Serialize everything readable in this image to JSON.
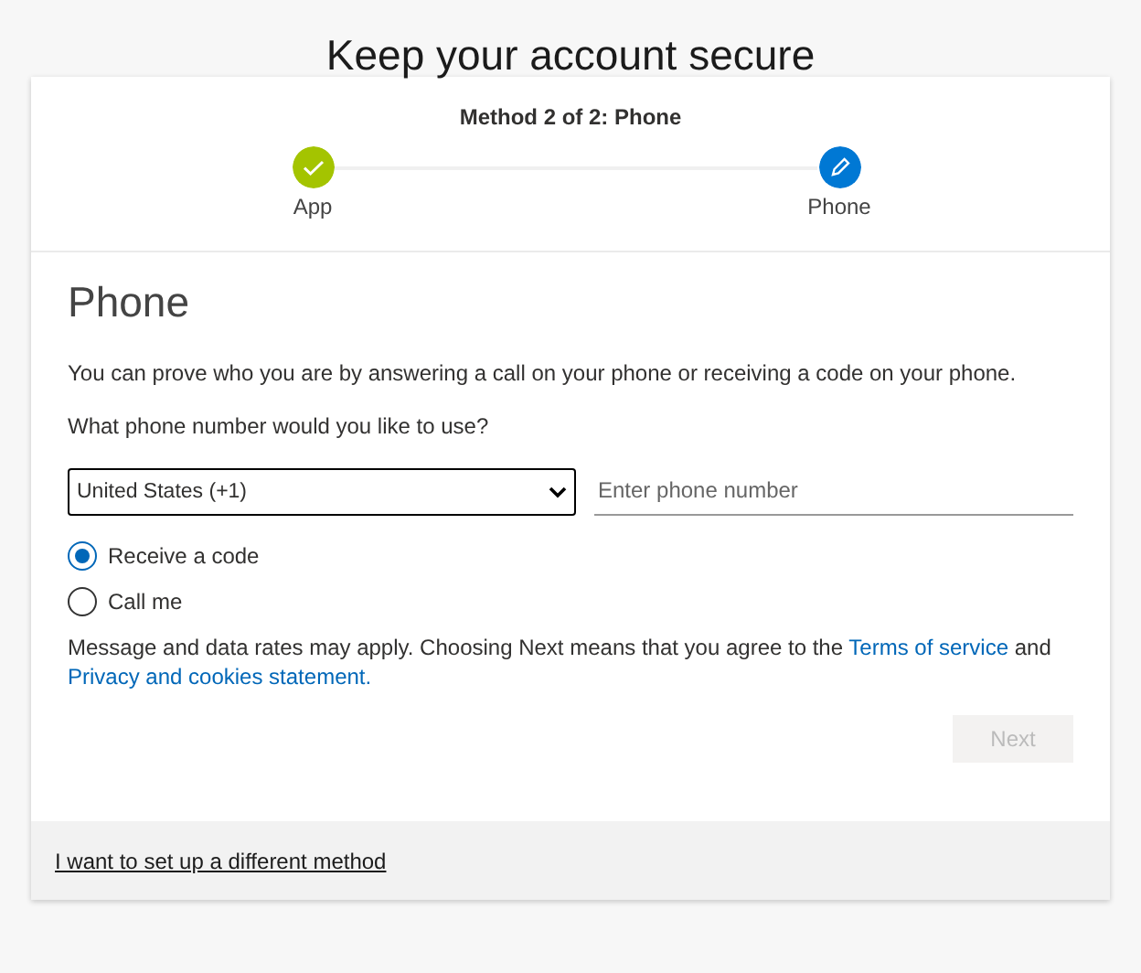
{
  "page_title": "Keep your account secure",
  "progress": {
    "title": "Method 2 of 2: Phone",
    "steps": [
      {
        "label": "App",
        "kind": "done"
      },
      {
        "label": "Phone",
        "kind": "current"
      }
    ]
  },
  "section_title": "Phone",
  "description": "You can prove who you are by answering a call on your phone or receiving a code on your phone.",
  "question": "What phone number would you like to use?",
  "country_select": {
    "value": "United States (+1)"
  },
  "phone_field": {
    "placeholder": "Enter phone number"
  },
  "options": [
    {
      "label": "Receive a code",
      "selected": true
    },
    {
      "label": "Call me",
      "selected": false
    }
  ],
  "notice": [
    {
      "kind": "text",
      "text": "Message and data rates may apply. Choosing Next means that you agree to the "
    },
    {
      "kind": "link",
      "text": "Terms of service"
    },
    {
      "kind": "text",
      "text": " and "
    },
    {
      "kind": "link",
      "text": "Privacy and cookies statement."
    }
  ],
  "next_button": {
    "label": "Next",
    "disabled": true
  },
  "footer_link": "I want to set up a different method"
}
